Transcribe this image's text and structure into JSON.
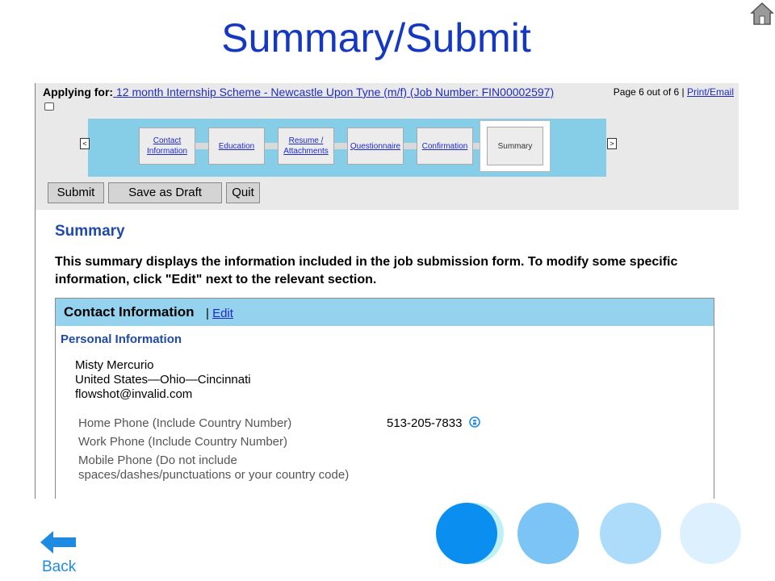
{
  "slide": {
    "title": "Summary/Submit",
    "back_label": "Back"
  },
  "header": {
    "applying_label": "Applying for:",
    "job_title_link": " 12 month Internship Scheme - Newcastle Upon Tyne (m/f) (Job Number: FIN00002597)",
    "page_info": "Page 6 out of 6",
    "separator": "|",
    "print_email": "Print/Email"
  },
  "steps": [
    {
      "label": "Contact Information"
    },
    {
      "label": "Education"
    },
    {
      "label": "Resume / Attachments"
    },
    {
      "label": "Questionnaire"
    },
    {
      "label": "Confirmation"
    }
  ],
  "current_step": "Summary",
  "nav": {
    "prev": "<",
    "next": ">"
  },
  "buttons": {
    "submit": "Submit",
    "save_draft": "Save as Draft",
    "quit": "Quit"
  },
  "summary": {
    "heading": "Summary",
    "description": "This summary displays the information included in the job submission form. To modify some specific information, click \"Edit\" next to the relevant section."
  },
  "section": {
    "title": "Contact Information",
    "separator": "|",
    "edit_label": "Edit",
    "personal_heading": "Personal Information",
    "name": "Misty Mercurio",
    "location": "United States—Ohio—Cincinnati",
    "email": "flowshot@invalid.com",
    "fields": [
      {
        "label": "Home Phone (Include Country Number)",
        "value": "513-205-7833"
      },
      {
        "label": "Work Phone (Include Country Number)",
        "value": ""
      },
      {
        "label": "Mobile Phone (Do not include spaces/dashes/punctuations or your country code)",
        "value": ""
      }
    ]
  },
  "colors": {
    "title_blue": "#1538c2",
    "step_bar": "#86cde8",
    "section_header": "#94d2ed",
    "circles": [
      "#0a8ff0",
      "#7cc4f5",
      "#addcfb",
      "#dcf0fe"
    ]
  }
}
